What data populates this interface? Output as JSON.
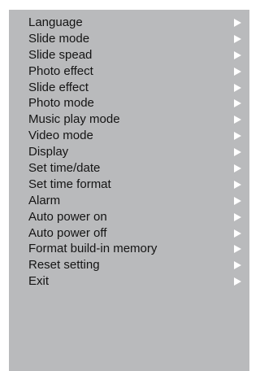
{
  "menu": {
    "items": [
      {
        "label": "Language",
        "icon": "chevron-right-icon"
      },
      {
        "label": "Slide mode",
        "icon": "chevron-right-icon"
      },
      {
        "label": "Slide spead",
        "icon": "chevron-right-icon"
      },
      {
        "label": "Photo effect",
        "icon": "chevron-right-icon"
      },
      {
        "label": "Slide effect",
        "icon": "chevron-right-icon"
      },
      {
        "label": "Photo mode",
        "icon": "chevron-right-icon"
      },
      {
        "label": "Music play mode",
        "icon": "chevron-right-icon"
      },
      {
        "label": "Video mode",
        "icon": "chevron-right-icon"
      },
      {
        "label": "Display",
        "icon": "chevron-right-icon"
      },
      {
        "label": "Set time/date",
        "icon": "chevron-right-icon"
      },
      {
        "label": "Set time format",
        "icon": "chevron-right-icon"
      },
      {
        "label": "Alarm",
        "icon": "chevron-right-icon"
      },
      {
        "label": "Auto power on",
        "icon": "chevron-right-icon"
      },
      {
        "label": "Auto power off",
        "icon": "chevron-right-icon"
      },
      {
        "label": "Format build-in memory",
        "icon": "chevron-right-icon"
      },
      {
        "label": "Reset setting",
        "icon": "chevron-right-icon"
      },
      {
        "label": "Exit",
        "icon": "chevron-right-icon"
      }
    ]
  },
  "colors": {
    "panel_background": "#b9babc",
    "text": "#141414",
    "arrow": "#ffffff"
  }
}
